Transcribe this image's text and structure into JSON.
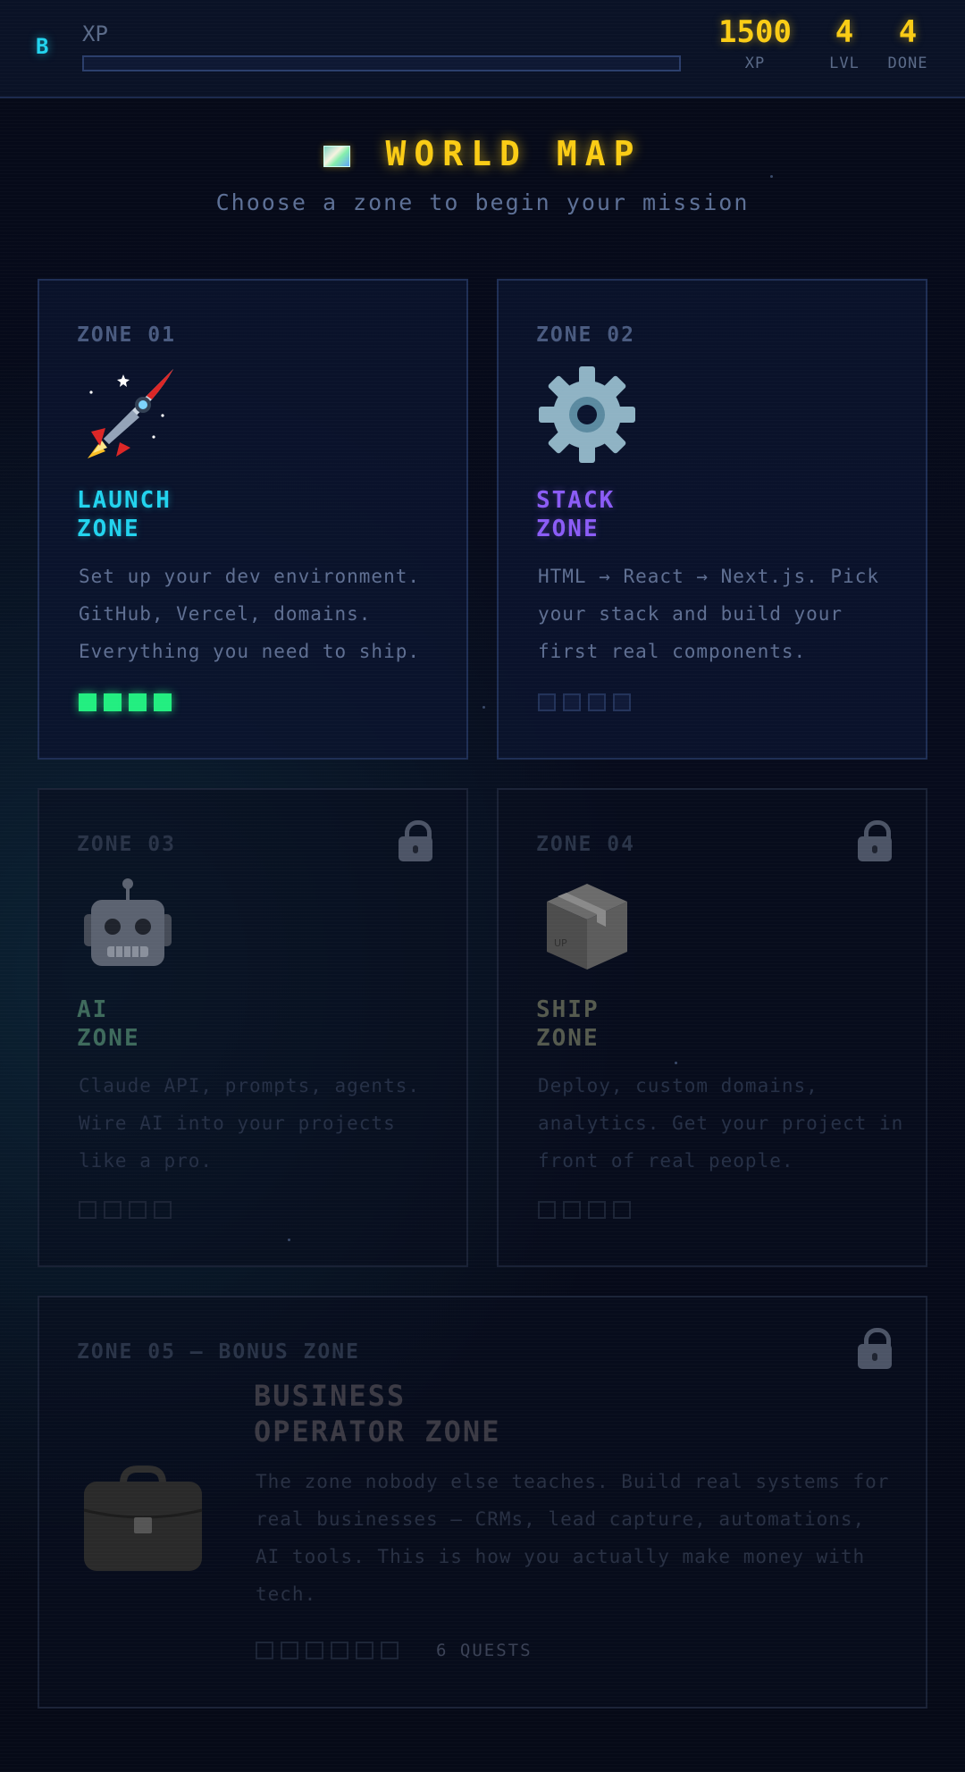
{
  "header": {
    "logo": "B",
    "xp_label": "XP",
    "xp_progress": 0,
    "stats": [
      {
        "value": "1500",
        "label": "XP"
      },
      {
        "value": "4",
        "label": "LVL"
      },
      {
        "value": "4",
        "label": "DONE"
      }
    ]
  },
  "title": "WORLD MAP",
  "subtitle": "Choose a zone to begin your mission",
  "zones": [
    {
      "label": "ZONE 01",
      "name": "LAUNCH\nZONE",
      "color": "#22d3ee",
      "icon": "rocket-icon",
      "locked": false,
      "description": "Set up your dev environment. GitHub, Vercel, domains. Everything you need to ship.",
      "quests_total": 4,
      "quests_done": 4
    },
    {
      "label": "ZONE 02",
      "name": "STACK\nZONE",
      "color": "#8b5cf6",
      "icon": "gear-icon",
      "locked": false,
      "description": "HTML → React → Next.js. Pick your stack and build your first real components.",
      "quests_total": 4,
      "quests_done": 0
    },
    {
      "label": "ZONE 03",
      "name": "AI\nZONE",
      "color": "#3e6a5c",
      "icon": "robot-icon",
      "locked": true,
      "description": "Claude API, prompts, agents. Wire AI into your projects like a pro.",
      "quests_total": 4,
      "quests_done": 0
    },
    {
      "label": "ZONE 04",
      "name": "SHIP\nZONE",
      "color": "#555a4e",
      "icon": "package-icon",
      "locked": true,
      "description": "Deploy, custom domains, analytics. Get your project in front of real people.",
      "quests_total": 4,
      "quests_done": 0
    }
  ],
  "bonus": {
    "label": "ZONE 05 — BONUS ZONE",
    "name": "BUSINESS\nOPERATOR ZONE",
    "icon": "briefcase-icon",
    "locked": true,
    "description": "The zone nobody else teaches. Build real systems for real businesses — CRMs, lead capture, automations, AI tools. This is how you actually make money with tech.",
    "quests_total": 6,
    "quests_label": "6 QUESTS"
  }
}
